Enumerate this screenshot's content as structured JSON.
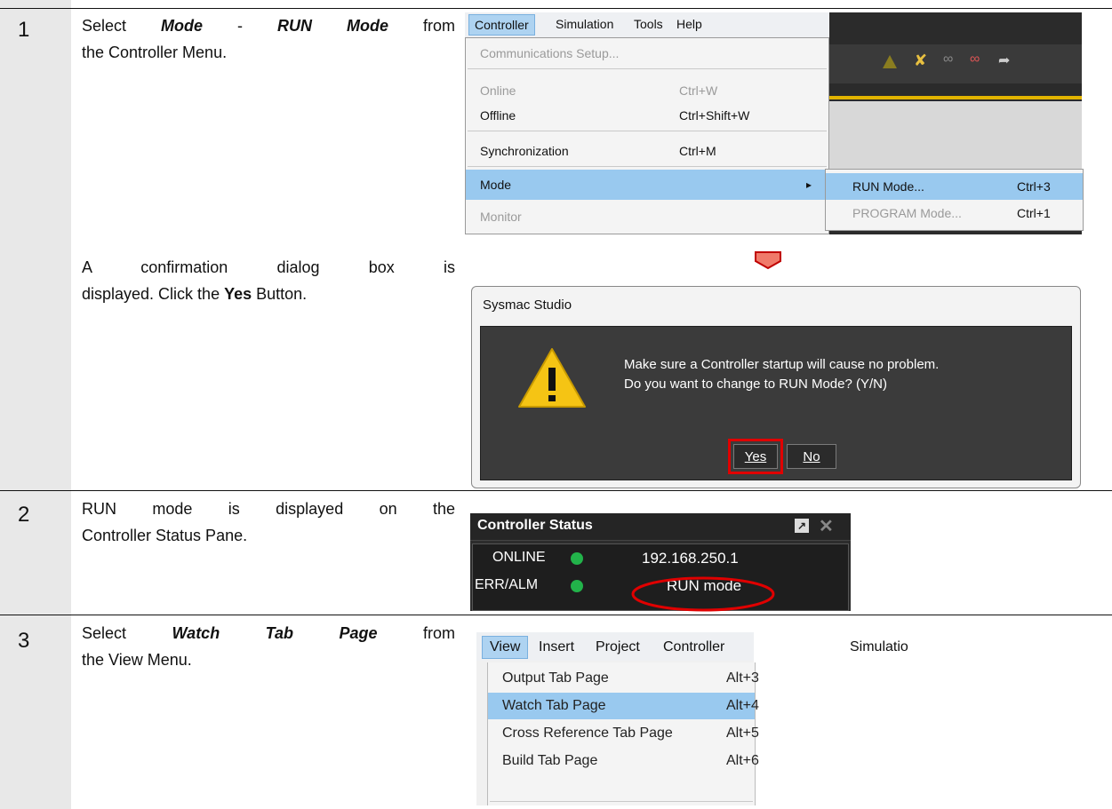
{
  "steps": [
    {
      "number": "1",
      "instruction": {
        "pre": "Select ",
        "item1": "Mode",
        "dash": " - ",
        "item2": "RUN Mode",
        "post_line1": " from",
        "line2": "the Controller Menu."
      },
      "confirm": {
        "line1": "A confirmation dialog box is",
        "pre": "displayed. Click the ",
        "button": "Yes",
        "post": " Button."
      }
    },
    {
      "number": "2",
      "instruction": {
        "line1": "RUN mode is displayed on the",
        "line2": "Controller Status Pane."
      }
    },
    {
      "number": "3",
      "instruction": {
        "pre": "Select ",
        "item": "Watch Tab Page",
        "post_line1": " from",
        "line2": "the View Menu."
      }
    }
  ],
  "controller_menu": {
    "menubar": [
      "Controller",
      "Simulation",
      "Tools",
      "Help"
    ],
    "items": [
      {
        "label": "Communications Setup...",
        "shortcut": "",
        "disabled": true
      },
      {
        "label": "Online",
        "shortcut": "Ctrl+W",
        "disabled": true
      },
      {
        "label": "Offline",
        "shortcut": "Ctrl+Shift+W",
        "disabled": false
      },
      {
        "label": "Synchronization",
        "shortcut": "Ctrl+M",
        "disabled": false
      },
      {
        "label": "Mode",
        "shortcut": "",
        "disabled": false,
        "highlighted": true,
        "submenu_arrow": "▸"
      },
      {
        "label": "Monitor",
        "shortcut": "",
        "disabled": true
      }
    ],
    "submenu": [
      {
        "label": "RUN Mode...",
        "shortcut": "Ctrl+3",
        "highlighted": true
      },
      {
        "label": "PROGRAM Mode...",
        "shortcut": "Ctrl+1",
        "disabled": true
      }
    ]
  },
  "dialog": {
    "title": "Sysmac Studio",
    "message_line1": "Make sure a Controller startup will cause no problem.",
    "message_line2": "Do you want to change to RUN Mode? (Y/N)",
    "yes_label": "Yes",
    "no_label": "No",
    "icon": "warning-icon"
  },
  "controller_status": {
    "title": "Controller Status",
    "row1_label": "ONLINE",
    "row1_value": "192.168.250.1",
    "row2_label": "ERR/ALM",
    "row2_value": "RUN mode"
  },
  "view_menu": {
    "menubar": [
      "View",
      "Insert",
      "Project",
      "Controller",
      "Simulatio"
    ],
    "items": [
      {
        "label": "Output Tab Page",
        "shortcut": "Alt+3"
      },
      {
        "label": "Watch Tab Page",
        "shortcut": "Alt+4",
        "highlighted": true
      },
      {
        "label": "Cross Reference Tab Page",
        "shortcut": "Alt+5"
      },
      {
        "label": "Build Tab Page",
        "shortcut": "Alt+6"
      }
    ]
  },
  "colors": {
    "highlight": "#99c9ef",
    "callout_red": "#e00000",
    "status_green": "#22b34a",
    "arrow_fill": "#f07a6a"
  }
}
